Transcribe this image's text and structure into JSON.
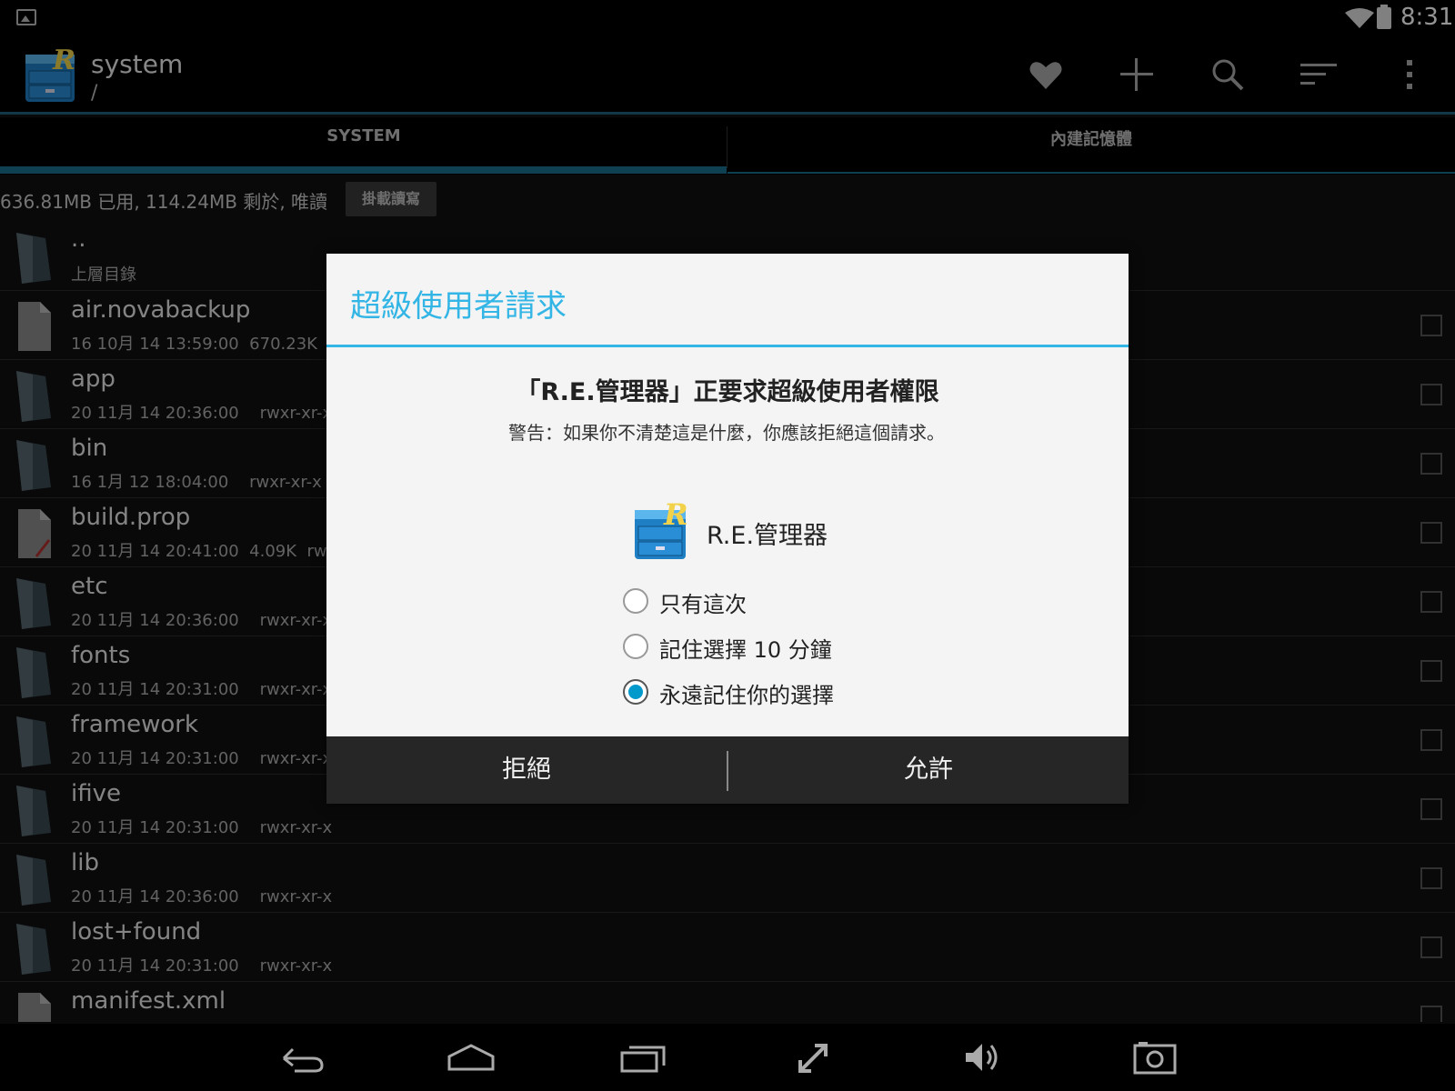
{
  "status_bar": {
    "time": "8:31"
  },
  "action_bar": {
    "title": "system",
    "subtitle": "/"
  },
  "tabs": [
    {
      "label": "SYSTEM",
      "active": true
    },
    {
      "label": "內建記憶體",
      "active": false
    }
  ],
  "info_bar": {
    "text": "636.81MB 已用, 114.24MB 剩於, 唯讀",
    "mount_button": "掛載讀寫"
  },
  "files": [
    {
      "name": "..",
      "meta": "上層目錄",
      "kind": "folder"
    },
    {
      "name": "air.novabackup",
      "meta": "16 10月 14 13:59:00  670.23K  rw-r",
      "kind": "file"
    },
    {
      "name": "app",
      "meta": "20 11月 14 20:36:00    rwxr-xr-x",
      "kind": "folder"
    },
    {
      "name": "bin",
      "meta": "16 1月 12 18:04:00    rwxr-xr-x",
      "kind": "folder"
    },
    {
      "name": "build.prop",
      "meta": "20 11月 14 20:41:00  4.09K  rw-r--r",
      "kind": "textfile"
    },
    {
      "name": "etc",
      "meta": "20 11月 14 20:36:00    rwxr-xr-x",
      "kind": "folder"
    },
    {
      "name": "fonts",
      "meta": "20 11月 14 20:31:00    rwxr-xr-x",
      "kind": "folder"
    },
    {
      "name": "framework",
      "meta": "20 11月 14 20:31:00    rwxr-xr-x",
      "kind": "folder"
    },
    {
      "name": "ifive",
      "meta": "20 11月 14 20:31:00    rwxr-xr-x",
      "kind": "folder"
    },
    {
      "name": "lib",
      "meta": "20 11月 14 20:36:00    rwxr-xr-x",
      "kind": "folder"
    },
    {
      "name": "lost+found",
      "meta": "20 11月 14 20:31:00    rwxr-xr-x",
      "kind": "folder"
    },
    {
      "name": "manifest.xml",
      "meta": "",
      "kind": "file"
    }
  ],
  "dialog": {
    "title": "超級使用者請求",
    "heading": "「R.E.管理器」正要求超級使用者權限",
    "warning": "警告：如果你不清楚這是什麼，你應該拒絕這個請求。",
    "app_name": "R.E.管理器",
    "options": [
      {
        "label": "只有這次",
        "checked": false
      },
      {
        "label": "記住選擇 10 分鐘",
        "checked": false
      },
      {
        "label": "永遠記住你的選擇",
        "checked": true
      }
    ],
    "deny_label": "拒絕",
    "allow_label": "允許"
  },
  "colors": {
    "accent": "#33b5e5",
    "tab_indicator": "#1b6f8d",
    "radio_checked": "#0099cc"
  },
  "icons": {
    "action_bar": [
      "heart-icon",
      "plus-icon",
      "search-icon",
      "sort-icon",
      "overflow-menu-icon"
    ],
    "nav_bar": [
      "back-icon",
      "home-icon",
      "recents-icon",
      "expand-icon",
      "volume-icon",
      "screenshot-icon"
    ]
  }
}
